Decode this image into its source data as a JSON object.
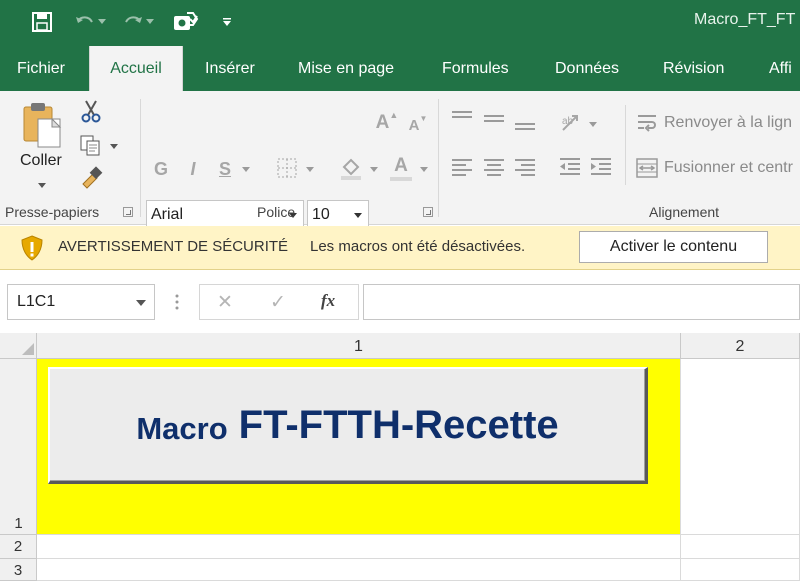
{
  "window": {
    "title": "Macro_FT_FT"
  },
  "quick_access": {
    "icons": [
      "save-icon",
      "undo-icon",
      "redo-icon",
      "macro-icon",
      "customize-dropdown-icon"
    ]
  },
  "tabs": [
    {
      "label": "Fichier",
      "active": false
    },
    {
      "label": "Accueil",
      "active": true
    },
    {
      "label": "Insérer",
      "active": false
    },
    {
      "label": "Mise en page",
      "active": false
    },
    {
      "label": "Formules",
      "active": false
    },
    {
      "label": "Données",
      "active": false
    },
    {
      "label": "Révision",
      "active": false
    },
    {
      "label": "Affi",
      "active": false
    }
  ],
  "ribbon": {
    "clipboard": {
      "label": "Presse-papiers",
      "paste_label": "Coller"
    },
    "font": {
      "label": "Police",
      "font_name": "Arial",
      "font_size": "10",
      "bold": "G",
      "italic": "I",
      "underline": "S",
      "font_color": "A",
      "grow": "A",
      "shrink": "A"
    },
    "alignment": {
      "label": "Alignement",
      "wrap_label": "Renvoyer à la lign",
      "merge_label": "Fusionner et centr"
    }
  },
  "security_bar": {
    "title": "AVERTISSEMENT DE SÉCURITÉ",
    "message": "Les macros ont été désactivées.",
    "button": "Activer le contenu"
  },
  "formula_bar": {
    "name_box": "L1C1",
    "cancel": "✕",
    "enter": "✓",
    "fx": "fx",
    "formula": ""
  },
  "sheet": {
    "columns": [
      "1",
      "2"
    ],
    "rows": [
      "1",
      "2",
      "3"
    ],
    "highlight_color": "#ffff00",
    "macro_button": {
      "prefix": "Macro",
      "name": "FT-FTTH-Recette",
      "text_color": "#0f2f6b"
    }
  },
  "colors": {
    "accent": "#217346",
    "warning_bg": "#fff4c6"
  }
}
